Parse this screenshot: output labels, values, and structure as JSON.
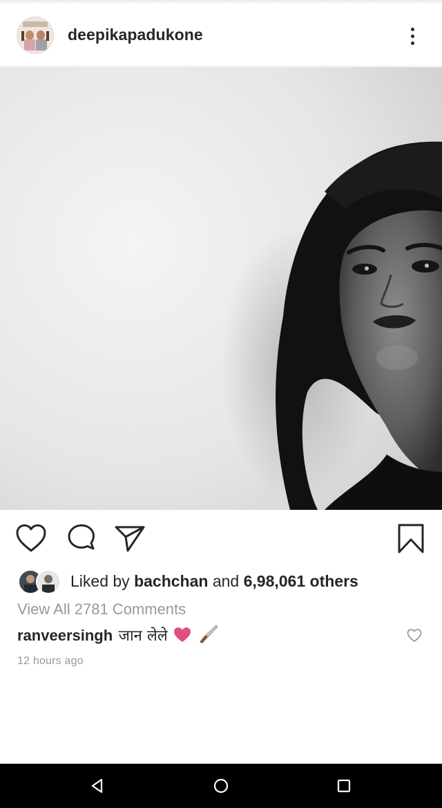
{
  "post": {
    "username": "deepikapadukone",
    "avatar_icon": "profile-avatar-magazine-cover",
    "more_icon": "more-vertical-icon"
  },
  "photo": {
    "description_icon": "bw-portrait-photo"
  },
  "actions": {
    "like_icon": "heart-outline-icon",
    "comment_icon": "comment-bubble-icon",
    "share_icon": "paper-plane-icon",
    "save_icon": "bookmark-outline-icon"
  },
  "likes": {
    "prefix": "Liked by",
    "liker": "bachchan",
    "joiner": "and",
    "count_text": "6,98,061 others"
  },
  "comments": {
    "view_all": "View All 2781 Comments",
    "top_comment": {
      "user": "ranveersingh",
      "text": "जान लेले",
      "emojis": [
        "pink-heart-emoji",
        "knife-emoji"
      ]
    }
  },
  "timestamp": "12 hours ago",
  "colors": {
    "text": "#262626",
    "muted": "#999999",
    "heart_pink": "#e0507f",
    "nav_bar": "#000000"
  },
  "nav": {
    "back_icon": "back-triangle-icon",
    "home_icon": "home-circle-icon",
    "recents_icon": "recents-square-icon"
  }
}
